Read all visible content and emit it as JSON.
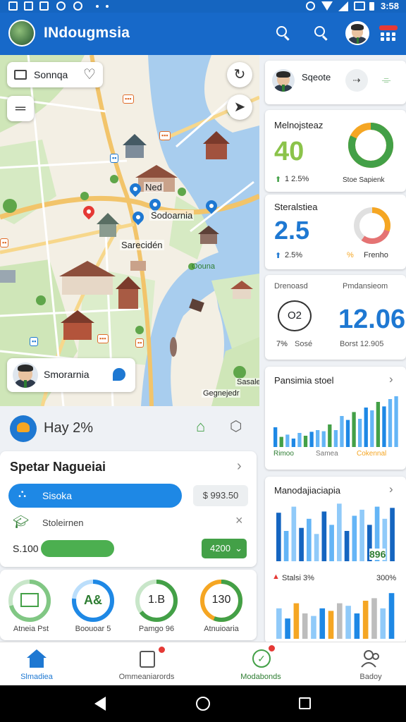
{
  "status_bar": {
    "time": "3:58"
  },
  "app_bar": {
    "title": "INdougmsia"
  },
  "map": {
    "search_card_label": "Sonnqa",
    "place_labels": [
      "Ned",
      "Sodoarnia",
      "Sarecidén",
      "Oouna",
      "Gegnejedr",
      "Sasale"
    ],
    "profile_card_name": "Smorarnia"
  },
  "weather_row": {
    "label": "Hay 2%"
  },
  "services_card": {
    "title": "Spetar Nagueiai",
    "primary_button": "Sisoka",
    "primary_value": "$ 993.50",
    "secondary_label": "Stoleirnen",
    "amount_label": "S.100",
    "dropdown_value": "4200"
  },
  "rings_row": {
    "items": [
      {
        "caption": "Atneia Pst",
        "value": ""
      },
      {
        "caption": "Boouoar 5",
        "value": "A&"
      },
      {
        "caption": "Pamgo 96",
        "value": "1.B"
      },
      {
        "caption": "Atnuioaria",
        "value": "130"
      }
    ]
  },
  "right_panel": {
    "profile_name": "Sqeote",
    "stat1": {
      "title": "Melnojsteaz",
      "value": "40",
      "change": "1 2.5%",
      "donut_label": "Stoe Sapienk",
      "fraction": 0.82
    },
    "stat2": {
      "title": "Steralstiea",
      "value": "2.5",
      "change": "2.5%",
      "donut_label": "Frenho",
      "donut_prefix": "%",
      "fraction": 0.6
    },
    "stat3": {
      "left_title": "Drenoasd",
      "right_title": "Pmdansieom",
      "bubble_value": "O2",
      "left_change": "7%",
      "left_sub": "Sosé",
      "big_value": "12.06",
      "right_sub": "Borst 12.905"
    },
    "chart1": {
      "title": "Pansimia stoel",
      "legend": [
        "Rimoo",
        "Samea",
        "Cokennal"
      ]
    },
    "chart2": {
      "title": "Manodajiaciapia",
      "value_label": "896",
      "mid_left": "Stalsi 3%",
      "mid_right": "300%"
    }
  },
  "bar_data": {
    "chart1": [
      0.35,
      0.18,
      0.22,
      0.15,
      0.25,
      0.2,
      0.27,
      0.3,
      0.28,
      0.4,
      0.3,
      0.55,
      0.48,
      0.62,
      0.5,
      0.7,
      0.65,
      0.8,
      0.72,
      0.85,
      0.9
    ],
    "chart2": [
      0.8,
      0.5,
      0.9,
      0.55,
      0.7,
      0.45,
      0.82,
      0.6,
      0.95,
      0.5,
      0.75,
      0.85,
      0.6,
      0.9,
      0.7,
      0.88
    ],
    "chart3": [
      0.6,
      0.4,
      0.7,
      0.5,
      0.45,
      0.6,
      0.55,
      0.7,
      0.65,
      0.5,
      0.75,
      0.8,
      0.6,
      0.9
    ]
  },
  "bottom_nav": {
    "items": [
      {
        "label": "Slmadiea"
      },
      {
        "label": "Ommeaniarords"
      },
      {
        "label": "Modabonds"
      },
      {
        "label": "Badoy"
      }
    ]
  },
  "colors": {
    "primary": "#1769c9",
    "green": "#43a047",
    "orange": "#f5a623"
  }
}
